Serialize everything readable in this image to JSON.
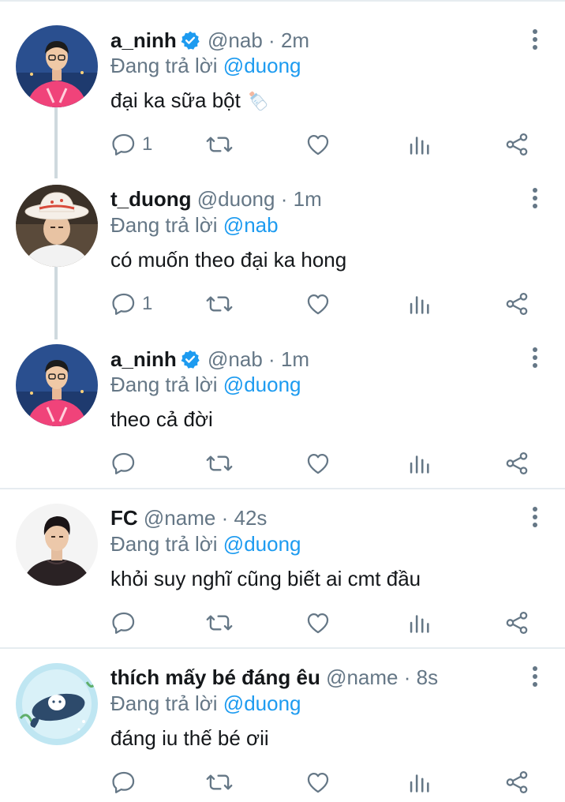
{
  "colors": {
    "accent": "#1d9bf0",
    "secondary_text": "#657786",
    "primary_text": "#14171a",
    "divider": "#e6ecf0",
    "thread_line": "#cfd9de"
  },
  "tweets": [
    {
      "name": "a_ninh",
      "verified": true,
      "handle": "@nab",
      "time": "2m",
      "reply_prefix": "Đang trả lời",
      "reply_to": "@duong",
      "text": "đại ka sữa bột",
      "emoji": "baby-bottle-icon",
      "reply_count": "1"
    },
    {
      "name": "t_duong",
      "verified": false,
      "handle": "@duong",
      "time": "1m",
      "reply_prefix": "Đang trả lời",
      "reply_to": "@nab",
      "text": "có muốn theo đại ka hong",
      "reply_count": "1"
    },
    {
      "name": "a_ninh",
      "verified": true,
      "handle": "@nab",
      "time": "1m",
      "reply_prefix": "Đang trả lời",
      "reply_to": "@duong",
      "text": "theo cả đời",
      "reply_count": ""
    },
    {
      "name": "FC",
      "verified": false,
      "handle": "@name",
      "time": "42s",
      "reply_prefix": "Đang trả lời",
      "reply_to": "@duong",
      "text": "khỏi suy nghĩ cũng biết ai cmt đầu",
      "reply_count": ""
    },
    {
      "name": "thích mấy bé đáng êu",
      "verified": false,
      "handle": "@name",
      "time": "8s",
      "reply_prefix": "Đang trả lời",
      "reply_to": "@duong",
      "text": "đáng iu thế bé ơii",
      "reply_count": ""
    }
  ],
  "separator": "·"
}
